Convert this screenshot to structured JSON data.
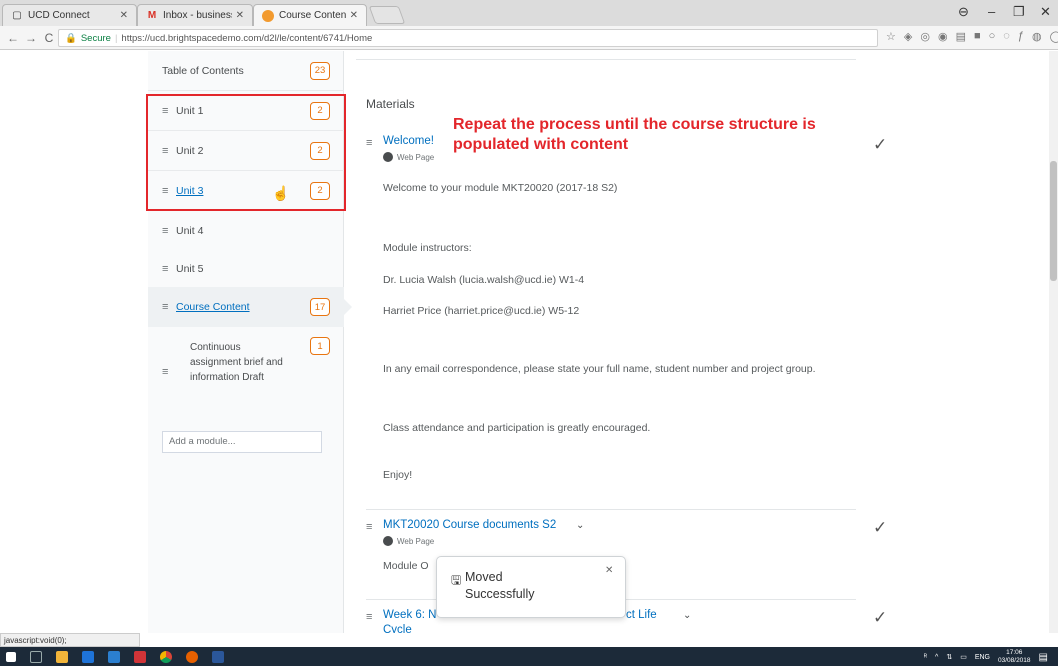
{
  "browser": {
    "tabs": [
      {
        "title": "UCD Connect",
        "icon": "page-icon"
      },
      {
        "title": "Inbox - business.elearnin",
        "icon": "gmail-icon",
        "icon_color": "#d93025"
      },
      {
        "title": "Course Content - EdTech",
        "icon": "brightspace-icon",
        "icon_color": "#f29a2e"
      }
    ],
    "secure_label": "Secure",
    "url": "https://ucd.brightspacedemo.com/d2l/le/content/6741/Home"
  },
  "sidebar": {
    "toc_label": "Table of Contents",
    "toc_count": "23",
    "units": [
      {
        "label": "Unit 1",
        "count": "2"
      },
      {
        "label": "Unit 2",
        "count": "2"
      },
      {
        "label": "Unit 3",
        "count": "2"
      },
      {
        "label": "Unit 4"
      },
      {
        "label": "Unit 5"
      }
    ],
    "course_content": {
      "label": "Course Content",
      "count": "17"
    },
    "sub_item": {
      "text": "Continuous assignment brief and information Draft",
      "count": "1"
    },
    "add_module_placeholder": "Add a module..."
  },
  "main": {
    "section_title": "Materials",
    "annotation": "Repeat the process until the course structure is populated with content",
    "items": [
      {
        "title": "Welcome!",
        "type": "Web Page"
      },
      {
        "title": "MKT20020 Course documents S2",
        "type": "Web Page"
      },
      {
        "title": "Week 6: N",
        "title_tail": "ct Life",
        "title_line2": "Cycle"
      }
    ],
    "welcome_text": [
      "Welcome to your module MKT20020 (2017-18 S2)",
      "Module instructors:",
      "Dr. Lucia Walsh (lucia.walsh@ucd.ie) W1-4",
      "Harriet Price (harriet.price@ucd.ie) W5-12",
      "In any email correspondence, please state your full name, student number and project group.",
      "Class attendance and participation is greatly encouraged.",
      "Enjoy!"
    ],
    "module_fragment": "Module O"
  },
  "toast": {
    "message": "Moved Successfully"
  },
  "status_bar": "javascript:void(0);",
  "taskbar": {
    "lang": "ENG",
    "time": "17:06",
    "date": "03/08/2018"
  },
  "colors": {
    "accent": "#006fbf",
    "count_badge": "#e87511",
    "annotation": "#e3262b"
  }
}
